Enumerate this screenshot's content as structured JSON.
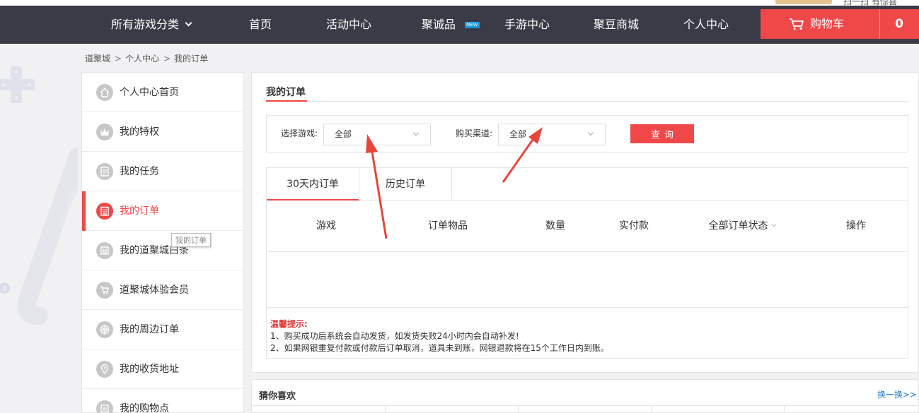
{
  "top_strip": {
    "cut_text": "扫一扫 有惊喜"
  },
  "nav": {
    "items": [
      {
        "label": "所有游戏分类",
        "has_caret": true
      },
      {
        "label": "首页"
      },
      {
        "label": "活动中心"
      },
      {
        "label": "聚诚品",
        "badge": "NEW"
      },
      {
        "label": "手游中心"
      },
      {
        "label": "聚豆商城"
      },
      {
        "label": "个人中心"
      }
    ],
    "cart": {
      "label": "购物车",
      "count": "0",
      "icon": "cart-icon"
    }
  },
  "breadcrumb": [
    "道聚城",
    "个人中心",
    "我的订单"
  ],
  "breadcrumb_sep": ">",
  "sidebar": {
    "items": [
      {
        "label": "个人中心首页",
        "icon": "home-icon"
      },
      {
        "label": "我的特权",
        "icon": "crown-icon"
      },
      {
        "label": "我的任务",
        "icon": "task-list-icon"
      },
      {
        "label": "我的订单",
        "icon": "order-list-icon",
        "active": true
      },
      {
        "label": "我的道聚城白条",
        "icon": "credit-icon"
      },
      {
        "label": "道聚城体验会员",
        "icon": "member-icon"
      },
      {
        "label": "我的周边订单",
        "icon": "target-icon"
      },
      {
        "label": "我的收货地址",
        "icon": "location-pin-icon"
      },
      {
        "label": "我的购物点",
        "icon": "points-icon"
      }
    ],
    "tooltip": "我的订单"
  },
  "main": {
    "title": "我的订单",
    "filters": {
      "game_label": "选择游戏:",
      "game_value": "全部",
      "channel_label": "购买渠道:",
      "channel_value": "全部",
      "query_label": "查询"
    },
    "tabs": [
      "30天内订单",
      "历史订单"
    ],
    "columns": [
      "游戏",
      "订单物品",
      "数量",
      "实付款",
      "全部订单状态",
      "操作"
    ],
    "tips": {
      "title": "温馨提示:",
      "lines": [
        "1、购买成功后系统会自动发货，如发货失败24小时内会自动补发!",
        "2、如果网银重复付款或付款后订单取消，道具未到账，网银退款将在15个工作日内到账。"
      ]
    }
  },
  "guess": {
    "title": "猜你喜欢",
    "more": "换一换>>"
  },
  "colors": {
    "accent": "#f04848",
    "nav_bg": "#3a3b47",
    "link": "#1e7ac9"
  }
}
